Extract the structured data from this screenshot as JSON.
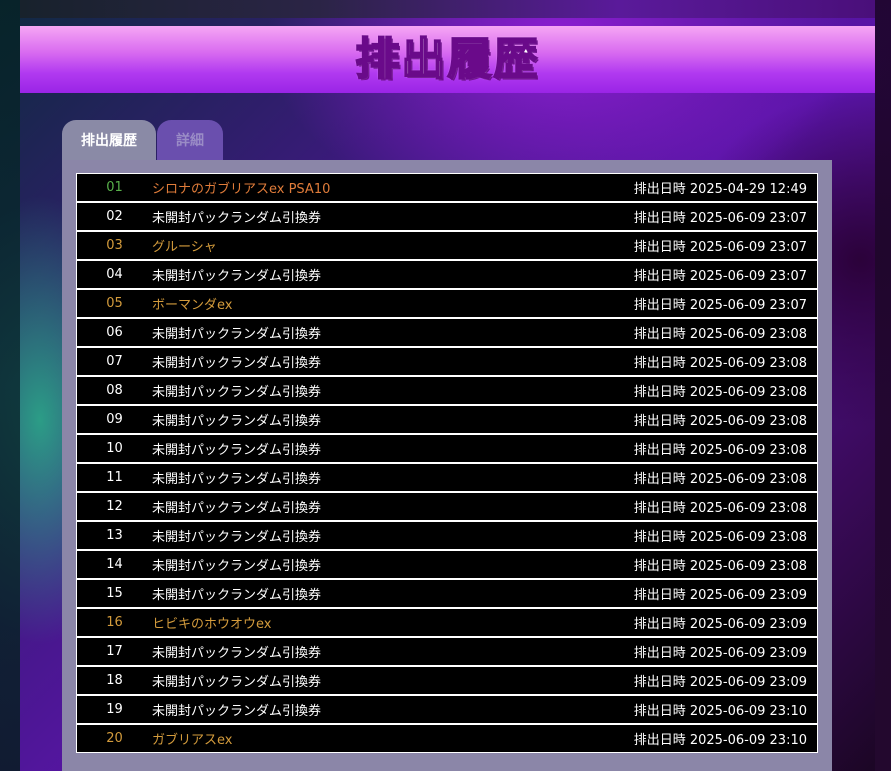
{
  "page": {
    "title": "排出履歴"
  },
  "tabs": [
    {
      "label": "排出履歴",
      "active": true
    },
    {
      "label": "詳細",
      "active": false
    }
  ],
  "colors": {
    "banner_top": "#f6a6f4",
    "banner_bottom": "#9a24e6",
    "row_bg": "#000000",
    "row_text": "#ffffff",
    "highlight_text": "#d39b3c",
    "top_num": "#58b04a",
    "top_name": "#e07c3a",
    "panel_bg": "#8b86a8"
  },
  "history": [
    {
      "num": "01",
      "name": "シロナのガブリアスex PSA10",
      "time": "排出日時 2025-04-29 12:49",
      "style": "top"
    },
    {
      "num": "02",
      "name": "未開封パックランダム引換券",
      "time": "排出日時 2025-06-09 23:07",
      "style": "normal"
    },
    {
      "num": "03",
      "name": "グルーシャ",
      "time": "排出日時 2025-06-09 23:07",
      "style": "special"
    },
    {
      "num": "04",
      "name": "未開封パックランダム引換券",
      "time": "排出日時 2025-06-09 23:07",
      "style": "normal"
    },
    {
      "num": "05",
      "name": "ボーマンダex",
      "time": "排出日時 2025-06-09 23:07",
      "style": "special"
    },
    {
      "num": "06",
      "name": "未開封パックランダム引換券",
      "time": "排出日時 2025-06-09 23:08",
      "style": "normal"
    },
    {
      "num": "07",
      "name": "未開封パックランダム引換券",
      "time": "排出日時 2025-06-09 23:08",
      "style": "normal"
    },
    {
      "num": "08",
      "name": "未開封パックランダム引換券",
      "time": "排出日時 2025-06-09 23:08",
      "style": "normal"
    },
    {
      "num": "09",
      "name": "未開封パックランダム引換券",
      "time": "排出日時 2025-06-09 23:08",
      "style": "normal"
    },
    {
      "num": "10",
      "name": "未開封パックランダム引換券",
      "time": "排出日時 2025-06-09 23:08",
      "style": "normal"
    },
    {
      "num": "11",
      "name": "未開封パックランダム引換券",
      "time": "排出日時 2025-06-09 23:08",
      "style": "normal"
    },
    {
      "num": "12",
      "name": "未開封パックランダム引換券",
      "time": "排出日時 2025-06-09 23:08",
      "style": "normal"
    },
    {
      "num": "13",
      "name": "未開封パックランダム引換券",
      "time": "排出日時 2025-06-09 23:08",
      "style": "normal"
    },
    {
      "num": "14",
      "name": "未開封パックランダム引換券",
      "time": "排出日時 2025-06-09 23:08",
      "style": "normal"
    },
    {
      "num": "15",
      "name": "未開封パックランダム引換券",
      "time": "排出日時 2025-06-09 23:09",
      "style": "normal"
    },
    {
      "num": "16",
      "name": "ヒビキのホウオウex",
      "time": "排出日時 2025-06-09 23:09",
      "style": "special"
    },
    {
      "num": "17",
      "name": "未開封パックランダム引換券",
      "time": "排出日時 2025-06-09 23:09",
      "style": "normal"
    },
    {
      "num": "18",
      "name": "未開封パックランダム引換券",
      "time": "排出日時 2025-06-09 23:09",
      "style": "normal"
    },
    {
      "num": "19",
      "name": "未開封パックランダム引換券",
      "time": "排出日時 2025-06-09 23:10",
      "style": "normal"
    },
    {
      "num": "20",
      "name": "ガブリアスex",
      "time": "排出日時 2025-06-09 23:10",
      "style": "special"
    }
  ]
}
